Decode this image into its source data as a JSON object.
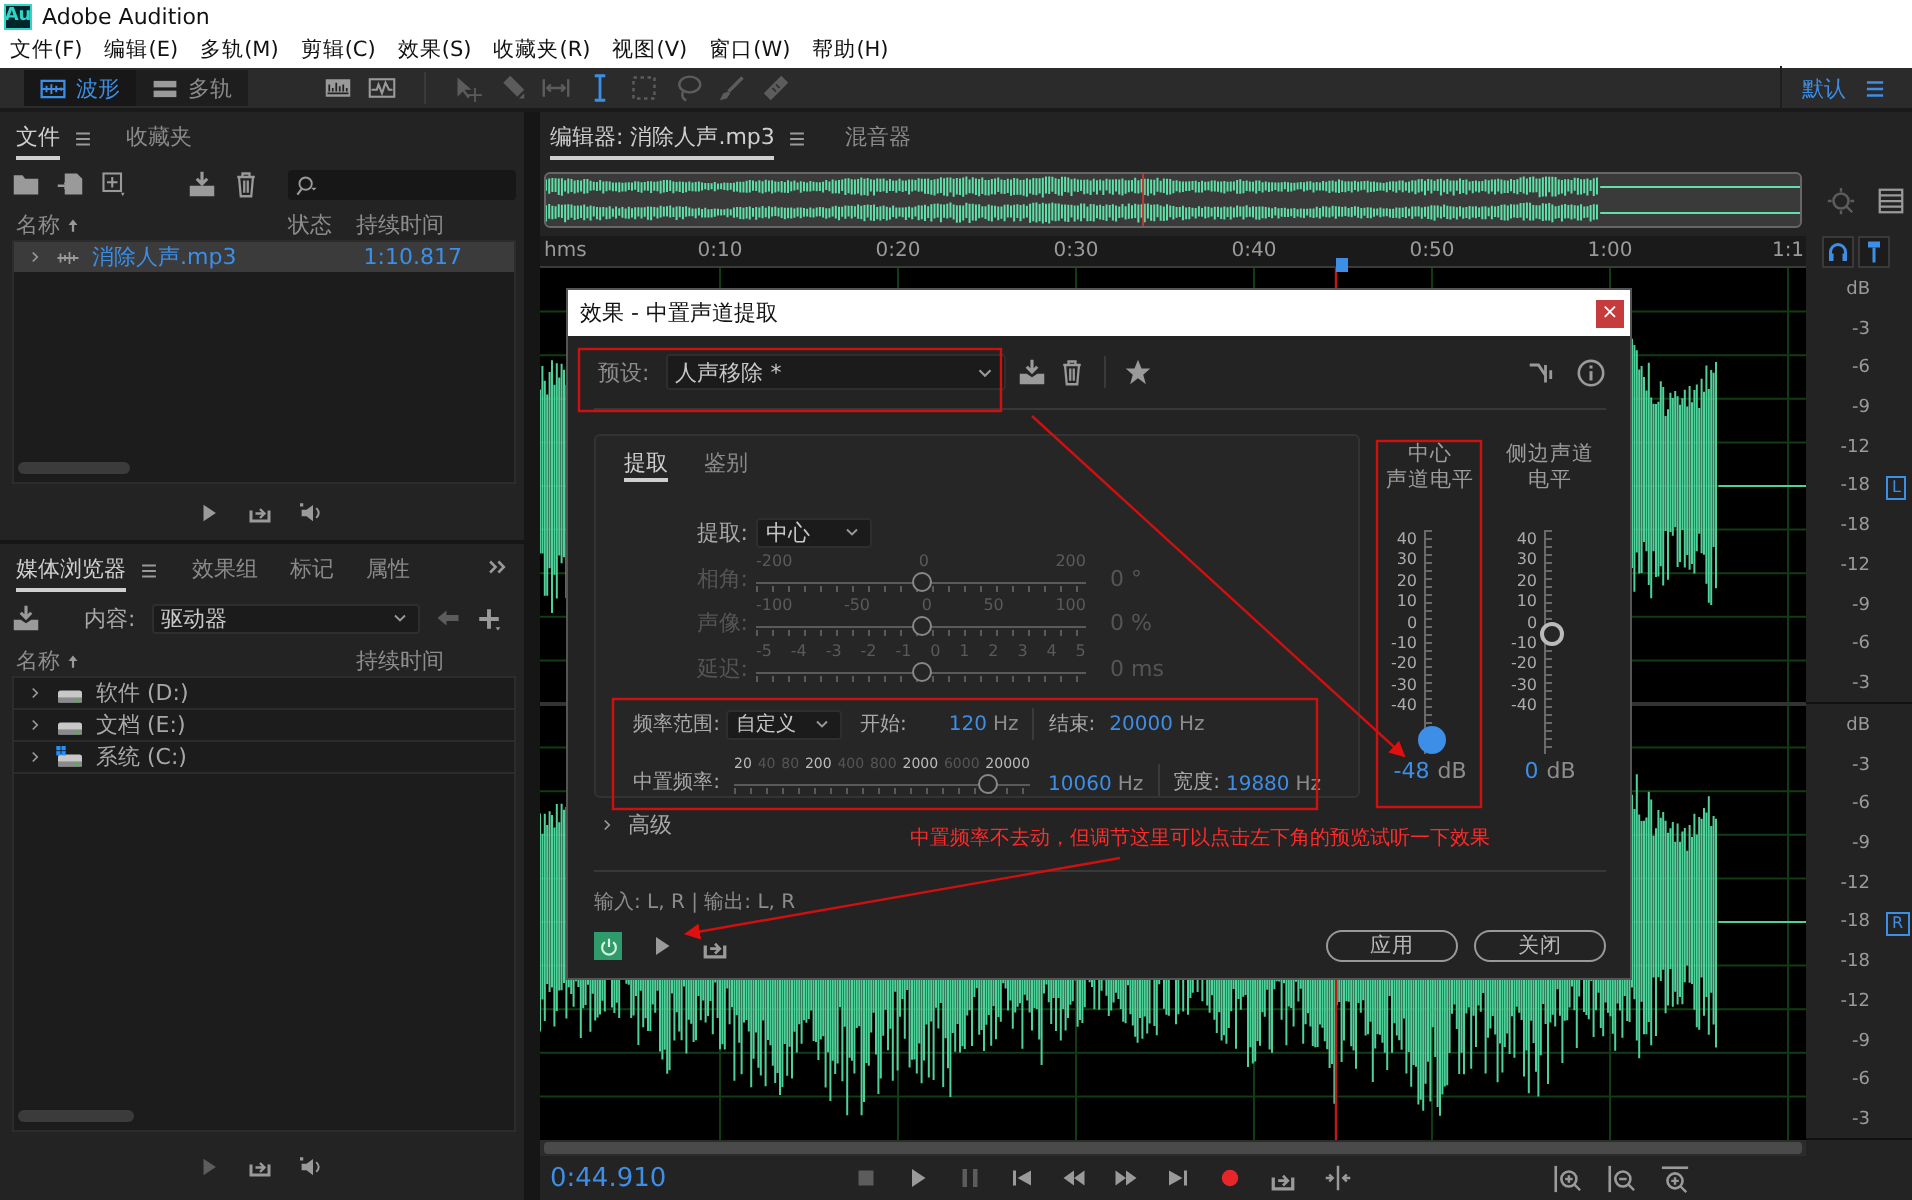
{
  "app": {
    "logo": "Au",
    "title": "Adobe Audition"
  },
  "menu": [
    "文件(F)",
    "编辑(E)",
    "多轨(M)",
    "剪辑(C)",
    "效果(S)",
    "收藏夹(R)",
    "视图(V)",
    "窗口(W)",
    "帮助(H)"
  ],
  "toolbar": {
    "modes": [
      {
        "label": "波形",
        "selected": true
      },
      {
        "label": "多轨",
        "selected": false
      }
    ],
    "workspace": "默认"
  },
  "files_panel": {
    "tabs": [
      {
        "label": "文件",
        "selected": true
      },
      {
        "label": "收藏夹",
        "selected": false
      }
    ],
    "columns": [
      "名称",
      "状态",
      "持续时间"
    ],
    "rows": [
      {
        "name": "消除人声.mp3",
        "duration": "1:10.817",
        "selected": true
      }
    ]
  },
  "media_panel": {
    "tabs": [
      {
        "label": "媒体浏览器",
        "selected": true
      },
      {
        "label": "效果组",
        "selected": false
      },
      {
        "label": "标记",
        "selected": false
      },
      {
        "label": "属性",
        "selected": false
      }
    ],
    "content_label": "内容:",
    "content_value": "驱动器",
    "columns": [
      "名称",
      "持续时间"
    ],
    "drives": [
      {
        "name": "软件 (D:)",
        "kind": "drive"
      },
      {
        "name": "文档 (E:)",
        "kind": "drive"
      },
      {
        "name": "系统 (C:)",
        "kind": "system"
      }
    ]
  },
  "editor": {
    "tabs": [
      {
        "label": "编辑器: 消除人声.mp3",
        "selected": true
      },
      {
        "label": "混音器",
        "selected": false
      }
    ],
    "ruler": [
      "hms",
      "0:10",
      "0:20",
      "0:30",
      "0:40",
      "0:50",
      "1:00",
      "1:1"
    ],
    "channels": [
      {
        "label": "L",
        "scale": [
          "dB",
          "-3",
          "-6",
          "-9",
          "-12",
          "-18",
          "-18",
          "-12",
          "-9",
          "-6",
          "-3"
        ]
      },
      {
        "label": "R",
        "scale": [
          "dB",
          "-3",
          "-6",
          "-9",
          "-12",
          "-18",
          "-18",
          "-12",
          "-9",
          "-6",
          "-3"
        ]
      }
    ],
    "time": "0:44.910"
  },
  "dialog": {
    "title": "效果 - 中置声道提取",
    "close": "×",
    "preset_label": "预设:",
    "preset": "人声移除 *",
    "tabs": [
      {
        "label": "提取",
        "selected": true
      },
      {
        "label": "鉴别",
        "selected": false
      }
    ],
    "extract_label": "提取:",
    "extract_value": "中心",
    "sliders": [
      {
        "label": "相角:",
        "ticks": [
          "-200",
          "0",
          "200"
        ],
        "level": 0.5,
        "reading": "0 °",
        "disabled": true
      },
      {
        "label": "声像:",
        "ticks": [
          "-100",
          "-50",
          "0",
          "50",
          "100"
        ],
        "level": 0.5,
        "reading": "0 %",
        "disabled": true
      },
      {
        "label": "延迟:",
        "ticks": [
          "-5",
          "-4",
          "-3",
          "-2",
          "-1",
          "0",
          "1",
          "2",
          "3",
          "4",
          "5"
        ],
        "level": 0.5,
        "reading": "0 ms",
        "disabled": true
      }
    ],
    "range_label": "频率范围:",
    "range_value": "自定义",
    "start_label": "开始:",
    "start_value": "120",
    "start_unit": "Hz",
    "end_label": "结束:",
    "end_value": "20000",
    "end_unit": "Hz",
    "center_label": "中置频率:",
    "center_ticks": [
      {
        "label": "20",
        "major": true
      },
      {
        "label": "40",
        "major": false
      },
      {
        "label": "80",
        "major": false
      },
      {
        "label": "200",
        "major": true
      },
      {
        "label": "400",
        "major": false
      },
      {
        "label": "800",
        "major": false
      },
      {
        "label": "2000",
        "major": true
      },
      {
        "label": "6000",
        "major": false
      },
      {
        "label": "20000",
        "major": true
      }
    ],
    "center_slider_level": {
      "level": 0.86
    },
    "center_value": "10060",
    "center_unit": "Hz",
    "width_label": "宽度:",
    "width_value": "19880",
    "width_unit": "Hz",
    "meters": [
      {
        "title_lines": [
          "中心",
          "声道电平"
        ],
        "ticks": [
          "40",
          "30",
          "20",
          "10",
          "0",
          "-10",
          "-20",
          "-30",
          "-40"
        ],
        "level": 0.0,
        "highlighted": true,
        "value": "-48",
        "unit": "dB"
      },
      {
        "title_lines": [
          "侧边声道",
          "电平"
        ],
        "ticks": [
          "40",
          "30",
          "20",
          "10",
          "0",
          "-10",
          "-20",
          "-30",
          "-40"
        ],
        "level": 0.53,
        "highlighted": false,
        "value": "0",
        "unit": "dB"
      }
    ],
    "advanced": "高级",
    "io": "输入: L, R | 输出: L, R",
    "power_on": true,
    "buttons": [
      "应用",
      "关闭"
    ]
  },
  "annotation": {
    "note": "中置频率不去动，但调节这里可以点击左下角的预览试听一下效果"
  }
}
